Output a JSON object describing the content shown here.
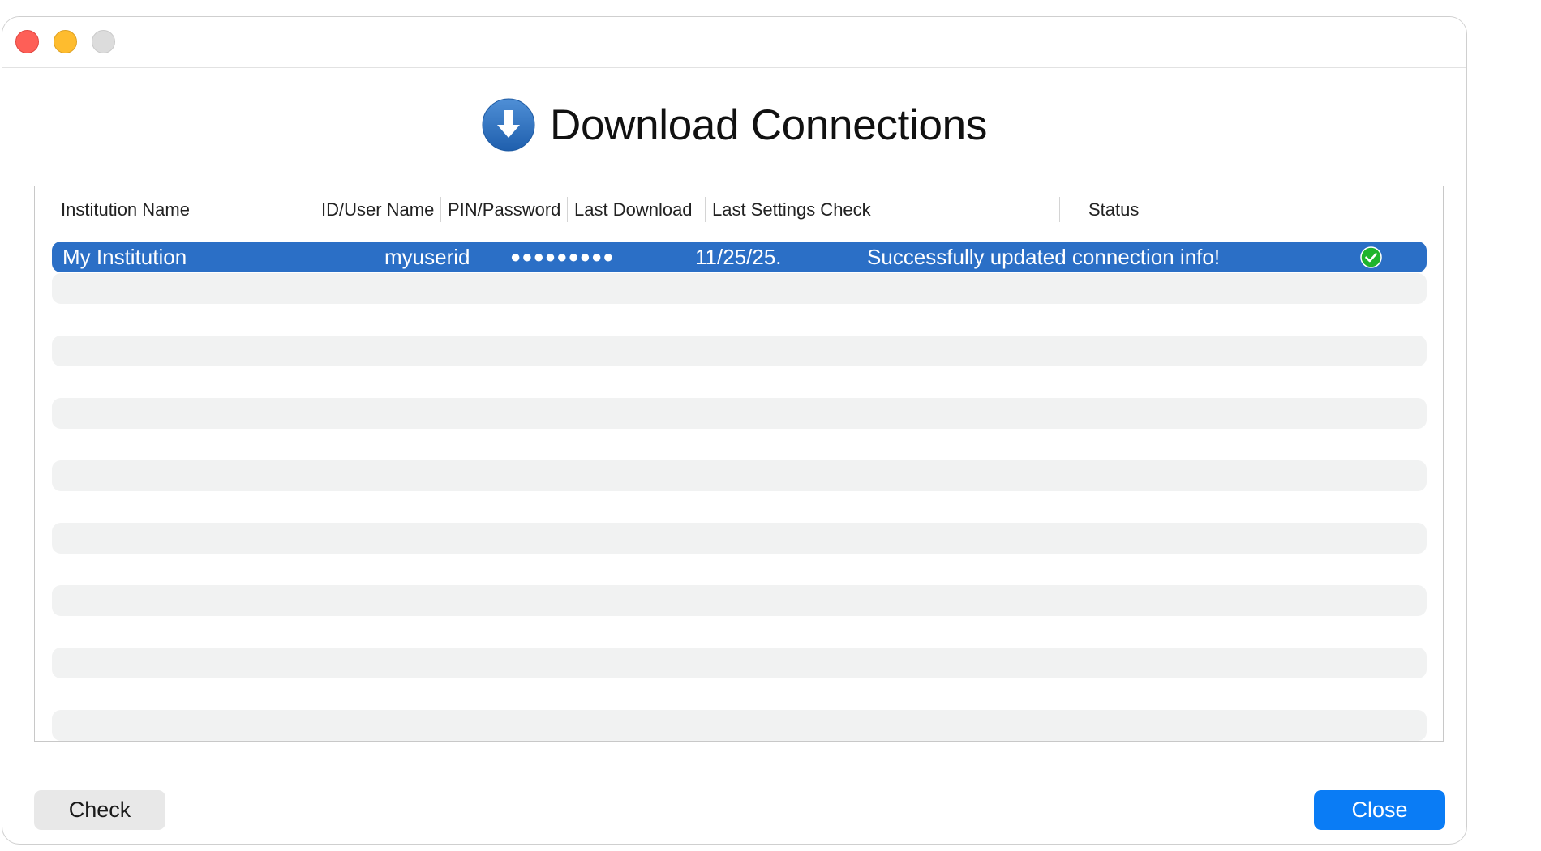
{
  "window": {
    "title": "Download Connections"
  },
  "table": {
    "columns": [
      "Institution Name",
      "ID/User Name",
      "PIN/Password",
      "Last Download",
      "Last Settings Check",
      "Status"
    ],
    "rows": [
      {
        "institution": "My Institution",
        "user": "myuserid",
        "password": "●●●●●●●●●",
        "last_download": "11/25/25.",
        "last_settings_check": "Successfully updated connection info!",
        "status": "success-check-icon"
      }
    ]
  },
  "buttons": {
    "check": "Check",
    "close": "Close"
  },
  "colors": {
    "selection": "#2b6fc6",
    "primary_button": "#0a7cf5",
    "status_success": "#1fb42c"
  }
}
